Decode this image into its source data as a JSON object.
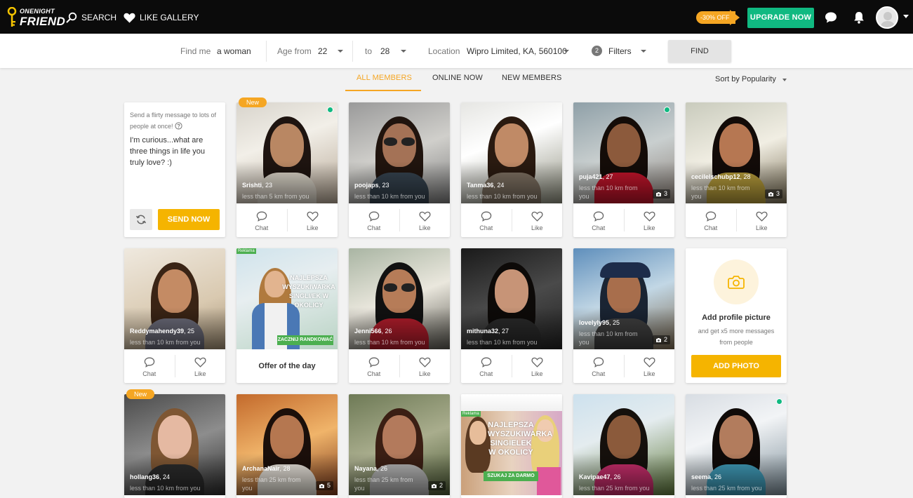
{
  "brand": {
    "line1": "ONENIGHT",
    "line2": "FRIEND"
  },
  "nav": {
    "search": "SEARCH",
    "like_gallery": "LIKE GALLERY"
  },
  "promo": {
    "discount": "-30% OFF",
    "upgrade": "UPGRADE NOW"
  },
  "filters": {
    "find_me_label": "Find me",
    "find_me_value": "a woman",
    "age_from_label": "Age from",
    "age_from_value": "22",
    "age_to_label": "to",
    "age_to_value": "28",
    "location_label": "Location",
    "location_value": "Wipro Limited, KA, 560100",
    "filters_count": "2",
    "filters_label": "Filters",
    "find_button": "FIND"
  },
  "tabs": [
    {
      "label": "ALL MEMBERS"
    },
    {
      "label": "ONLINE NOW"
    },
    {
      "label": "NEW MEMBERS"
    }
  ],
  "sort": {
    "label": "Sort by Popularity"
  },
  "message_card": {
    "hint": "Send a flirty message to lots of people at once!",
    "message": "I'm curious...what are three things in life you truly love? :)",
    "send_button": "SEND NOW"
  },
  "actions": {
    "chat": "Chat",
    "like": "Like"
  },
  "new_label": "New",
  "offer": {
    "title": "Offer of the day",
    "ad1_tag": "Reklama",
    "ad1_headline": "NAJLEPSZA WYSZUKIWARKA SINGLI/EK W OKOLICY",
    "ad1_cta": "ZACZNIJ RANDKOWAĆ",
    "ad2_tag": "Reklama",
    "ad2_headline": "NAJLEPSZA WYSZUKIWARKA SINGIELEK W OKOLICY",
    "ad2_cta": "SZUKAJ ZA DARMO"
  },
  "add_photo": {
    "title": "Add profile picture",
    "subtitle": "and get x5 more messages from people",
    "button": "ADD PHOTO"
  },
  "profiles": [
    {
      "name": "Srishti",
      "age": ", 23",
      "distance": "less than 5 km from you",
      "online": true,
      "isnew": true
    },
    {
      "name": "poojaps",
      "age": ", 23",
      "distance": "less than 10 km from you"
    },
    {
      "name": "Tanma36",
      "age": ", 24",
      "distance": "less than 10 km from you"
    },
    {
      "name": "puja421",
      "age": ", 27",
      "distance": "less than 10 km from you",
      "online": true,
      "photos": "3"
    },
    {
      "name": "cecilelschubp12",
      "age": ", 28",
      "distance": "less than 10 km from you",
      "photos": "3"
    },
    {
      "name": "Reddymahendy39",
      "age": ", 25",
      "distance": "less than 10 km from you"
    },
    {
      "name": "Jenni566",
      "age": ", 26",
      "distance": "less than 10 km from you"
    },
    {
      "name": "mithuna32",
      "age": ", 27",
      "distance": "less than 10 km from you"
    },
    {
      "name": "lovelyly95",
      "age": ", 25",
      "distance": "less than 10 km from you",
      "photos": "2"
    },
    {
      "name": "hollang36",
      "age": ", 24",
      "distance": "less than 10 km from you",
      "isnew": true
    },
    {
      "name": "ArchanaNair",
      "age": ", 28",
      "distance": "less than 25 km from you",
      "photos": "5"
    },
    {
      "name": "Nayana",
      "age": ", 26",
      "distance": "less than 25 km from you",
      "photos": "2"
    },
    {
      "name": "Kavipae47",
      "age": ", 26",
      "distance": "less than 25 km from you"
    },
    {
      "name": "seema",
      "age": ", 26",
      "distance": "less than 25 km from you",
      "online": true
    }
  ]
}
